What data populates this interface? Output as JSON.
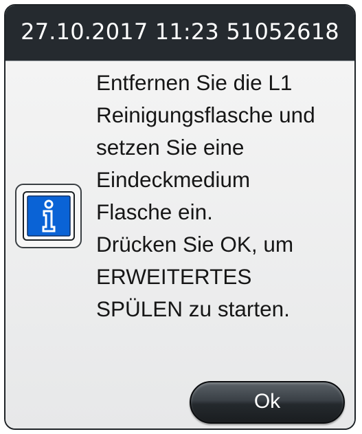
{
  "dialog": {
    "title": "27.10.2017 11:23 51052618",
    "icon": "info-icon",
    "message": "Entfernen Sie die L1\nReinigungsflasche und\nsetzen Sie eine\nEindeckmedium\nFlasche ein.\nDrücken Sie OK, um\nERWEITERTES\nSPÜLEN zu starten.",
    "ok_label": "Ok"
  },
  "colors": {
    "title_bar": "#252a2f",
    "body_background": "#edeeef",
    "info_icon_blue": "#0a63d6",
    "button_dark": "#24292d"
  }
}
